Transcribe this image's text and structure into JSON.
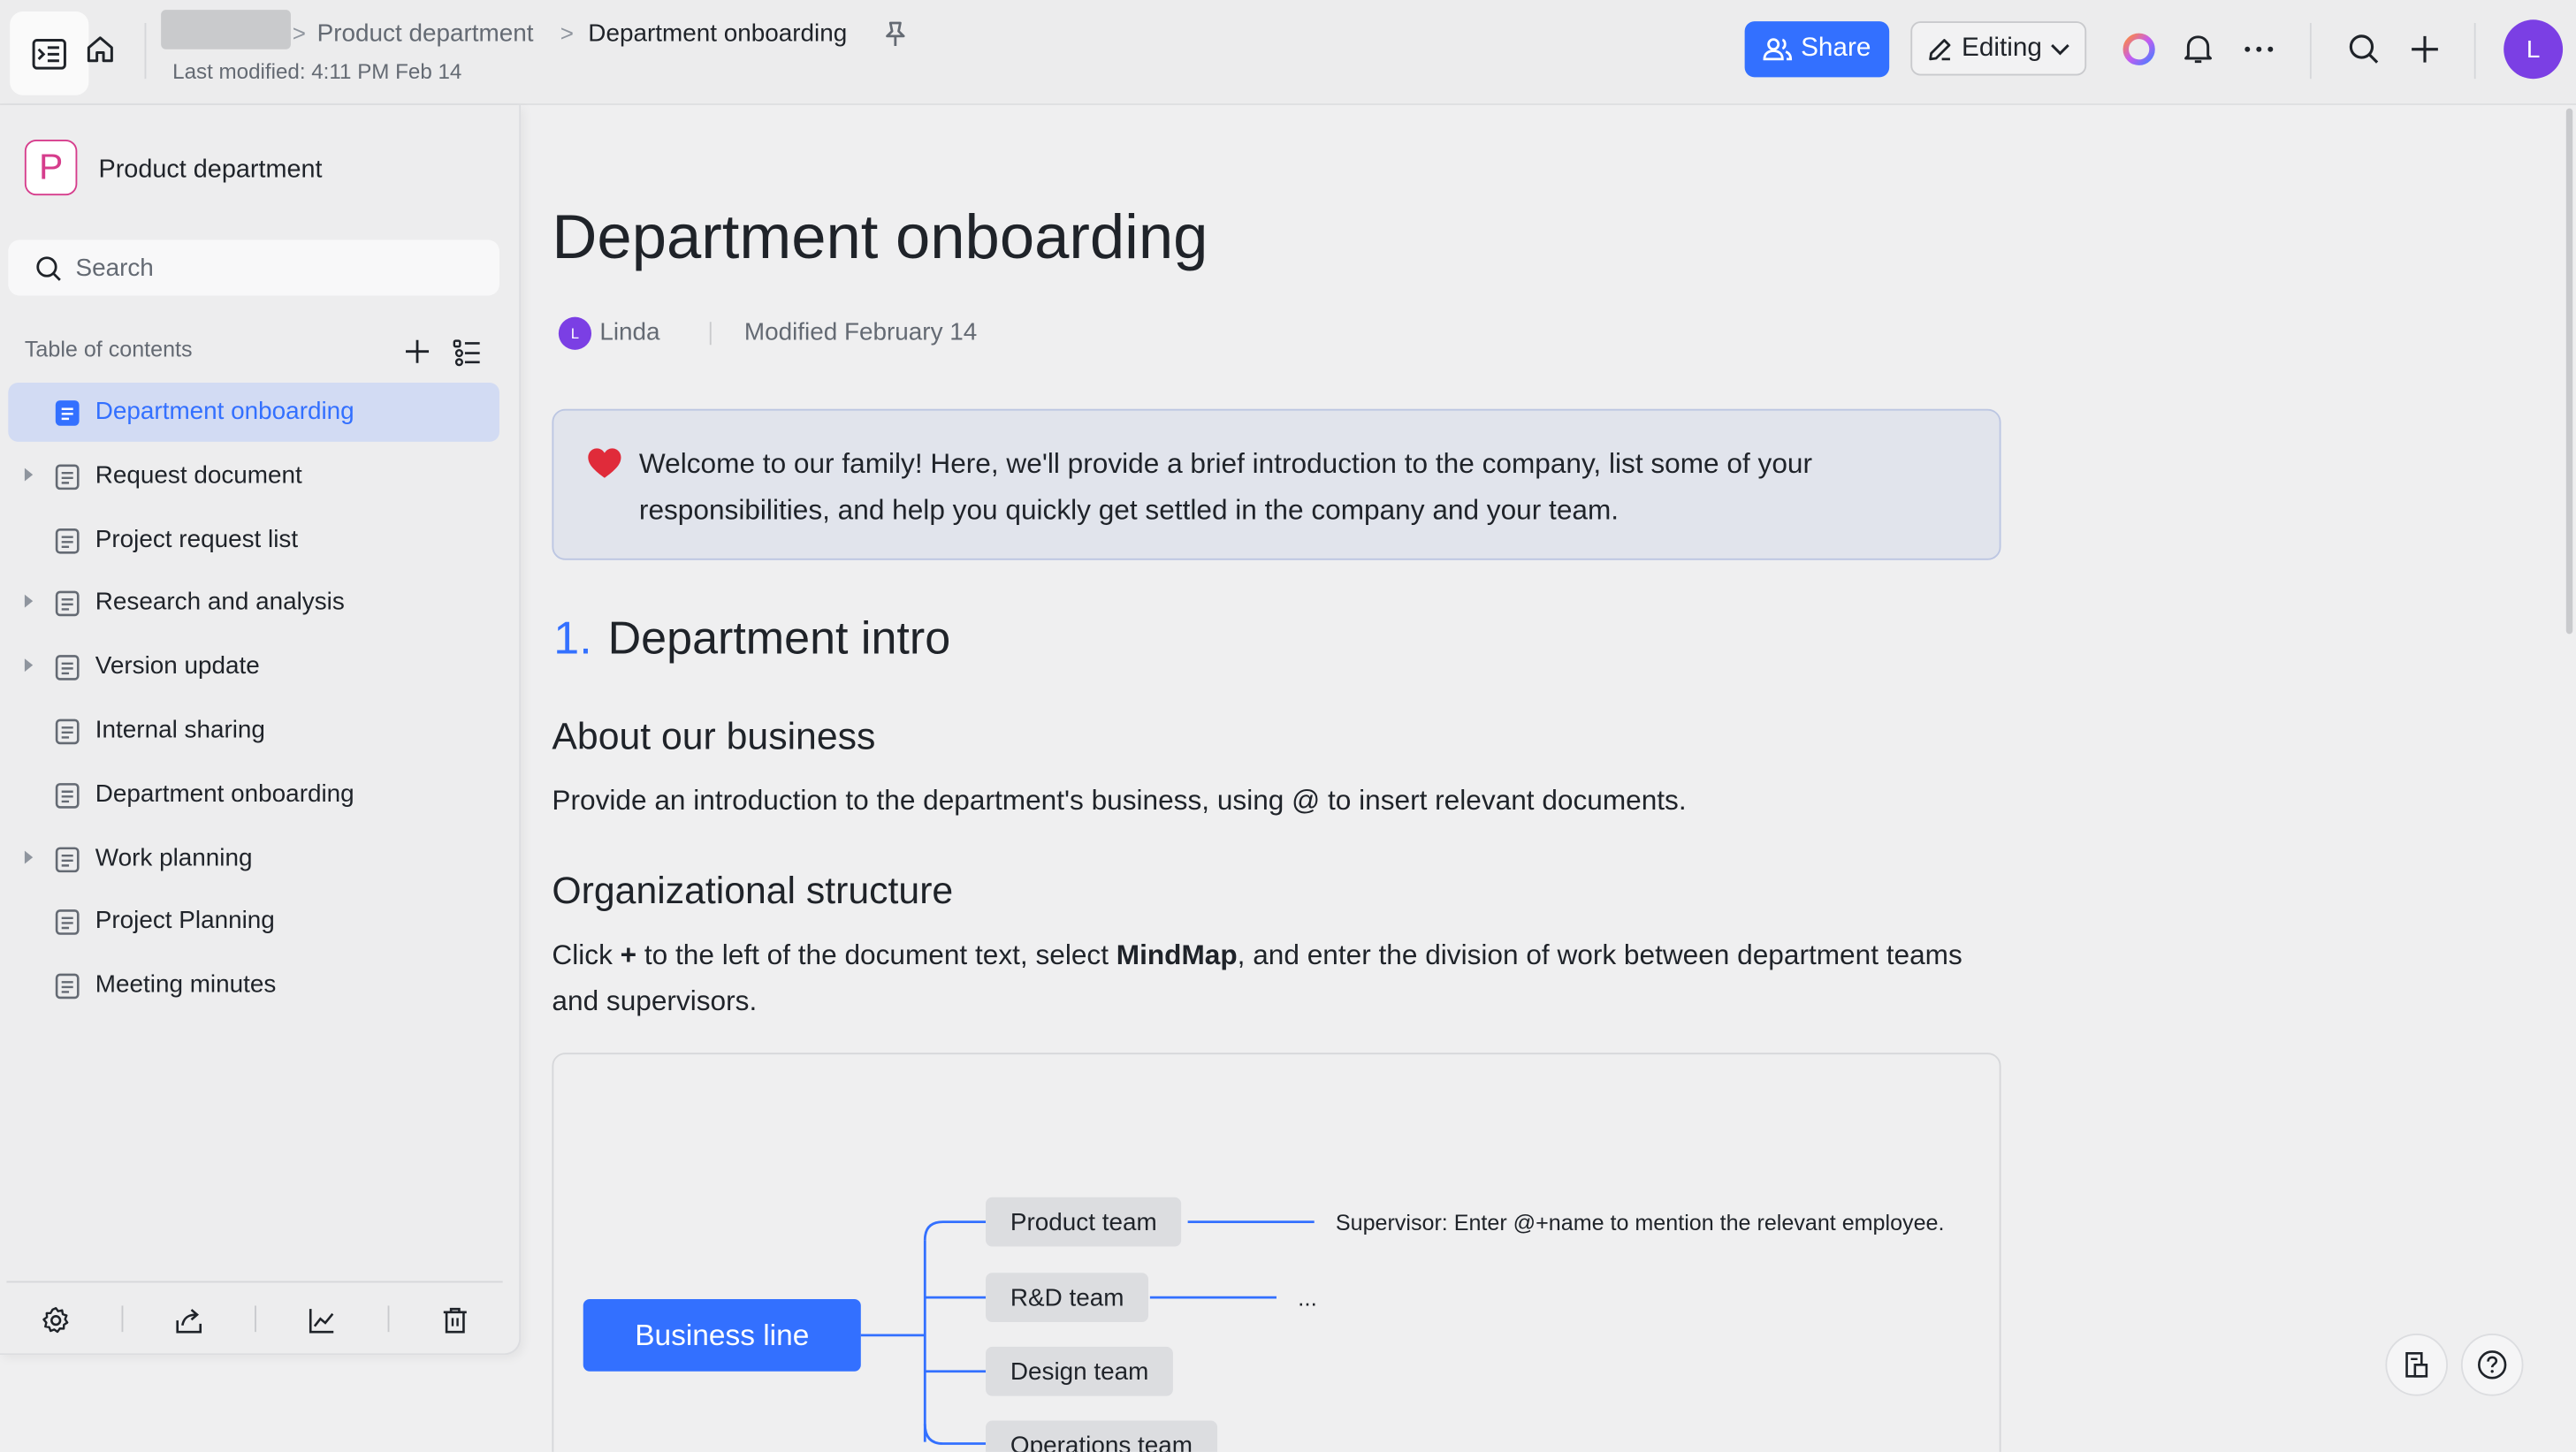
{
  "topbar": {
    "breadcrumb_parent": "Product department",
    "breadcrumb_current": "Department onboarding",
    "breadcrumb_sep": ">",
    "last_modified": "Last modified: 4:11 PM Feb 14",
    "share_label": "Share",
    "editing_label": "Editing",
    "user_initial": "L"
  },
  "sidebar": {
    "space_initial": "P",
    "space_name": "Product department",
    "search_placeholder": "Search",
    "toc_label": "Table of contents",
    "items": [
      {
        "label": "Department onboarding",
        "active": true,
        "expandable": false
      },
      {
        "label": "Request document",
        "active": false,
        "expandable": true
      },
      {
        "label": "Project request list",
        "active": false,
        "expandable": false
      },
      {
        "label": "Research and analysis",
        "active": false,
        "expandable": true
      },
      {
        "label": "Version update",
        "active": false,
        "expandable": true
      },
      {
        "label": "Internal sharing",
        "active": false,
        "expandable": false
      },
      {
        "label": "Department onboarding",
        "active": false,
        "expandable": false
      },
      {
        "label": "Work planning",
        "active": false,
        "expandable": true
      },
      {
        "label": "Project Planning",
        "active": false,
        "expandable": false
      },
      {
        "label": "Meeting minutes",
        "active": false,
        "expandable": false
      }
    ]
  },
  "doc": {
    "title": "Department onboarding",
    "author_initial": "L",
    "author": "Linda",
    "modified": "Modified February 14",
    "callout": "Welcome to our family! Here, we'll provide a brief introduction to the company, list some of your responsibilities, and help you quickly get settled in the company and your team.",
    "h1_number": "1.",
    "h1_text": "Department intro",
    "h2_about": "About our business",
    "p_about": "Provide an introduction to the department's business, using @ to insert relevant documents.",
    "h2_org": "Organizational structure",
    "p_org_1": "Click ",
    "p_org_plus": "+",
    "p_org_2": " to the left of the document text, select ",
    "p_org_mindmap": "MindMap",
    "p_org_3": ", and enter the division of work between department teams and supervisors."
  },
  "mindmap": {
    "root": "Business line",
    "nodes": [
      "Product team",
      "R&D team",
      "Design team",
      "Operations team"
    ],
    "note1": "Supervisor: Enter @+name to mention the relevant employee.",
    "note2": "..."
  },
  "colors": {
    "accent": "#3370ff",
    "avatar": "#7b3fe4",
    "space_logo": "#d63d8c"
  }
}
